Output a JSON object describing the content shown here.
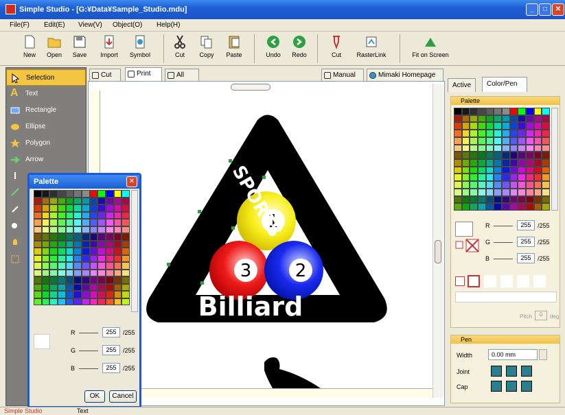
{
  "window": {
    "title": "Simple Studio - [G:¥Data¥Sample_Studio.mdu]"
  },
  "menu": [
    "File(F)",
    "Edit(E)",
    "View(V)",
    "Object(O)",
    "Help(H)"
  ],
  "toolbar": {
    "new": "New",
    "open": "Open",
    "save": "Save",
    "import": "Import",
    "symbol": "Symbol",
    "cut": "Cut",
    "copy": "Copy",
    "paste": "Paste",
    "undo": "Undo",
    "redo": "Redo",
    "cut2": "Cut",
    "rasterlink": "RasterLink",
    "fit": "Fit on Screen"
  },
  "tools": [
    "Selection",
    "Text",
    "Rectangle",
    "Ellipse",
    "Polygon",
    "Arrow"
  ],
  "doc_tabs": [
    "Cut",
    "Print",
    "All"
  ],
  "right_tabs_top": [
    "Manual",
    "Mimaki Homepage"
  ],
  "panel_tabs": [
    "Active",
    "Color/Pen"
  ],
  "palette": {
    "title": "Palette",
    "rgb": [
      {
        "label": "R",
        "value": "255",
        "max": "/255"
      },
      {
        "label": "G",
        "value": "255",
        "max": "/255"
      },
      {
        "label": "B",
        "value": "255",
        "max": "/255"
      }
    ],
    "pitch_label": "Pitch",
    "pitch_value": "0",
    "pitch_unit": "deg"
  },
  "pen": {
    "title": "Pen",
    "width_label": "Width",
    "width_value": "0.00 mm",
    "joint_label": "Joint",
    "cap_label": "Cap"
  },
  "dialog": {
    "title": "Palette",
    "ok": "OK",
    "cancel": "Cancel"
  },
  "artwork": {
    "sports": "SPORTS",
    "billiard": "Billiard",
    "balls": [
      "1",
      "2",
      "3"
    ]
  },
  "status": {
    "app": "Simple Studio",
    "mode": "Text"
  }
}
